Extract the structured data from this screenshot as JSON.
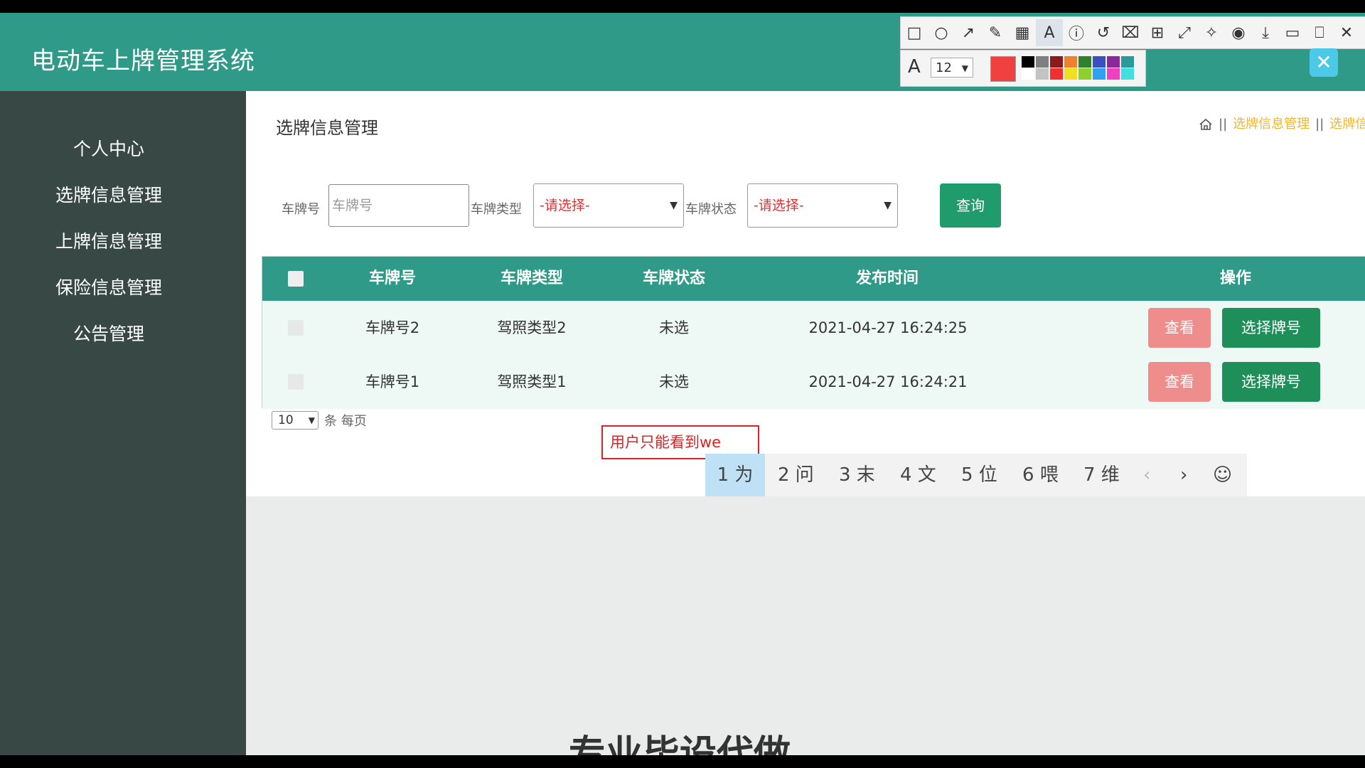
{
  "app": {
    "title": "电动车上牌管理系统"
  },
  "sidebar": {
    "items": [
      {
        "label": "个人中心"
      },
      {
        "label": "选牌信息管理"
      },
      {
        "label": "上牌信息管理"
      },
      {
        "label": "保险信息管理"
      },
      {
        "label": "公告管理"
      }
    ]
  },
  "page": {
    "title": "选牌信息管理"
  },
  "breadcrumb": {
    "items": [
      "选牌信息管理",
      "选牌信"
    ]
  },
  "search": {
    "plate_label": "车牌号",
    "plate_placeholder": "车牌号",
    "type_label": "车牌类型",
    "type_selected": "-请选择-",
    "status_label": "车牌状态",
    "status_selected": "-请选择-",
    "query_label": "查询"
  },
  "table": {
    "headers": [
      "车牌号",
      "车牌类型",
      "车牌状态",
      "发布时间",
      "操作"
    ],
    "rows": [
      {
        "plate": "车牌号2",
        "type": "驾照类型2",
        "status": "未选",
        "time": "2021-04-27 16:24:25",
        "view": "查看",
        "pick": "选择牌号"
      },
      {
        "plate": "车牌号1",
        "type": "驾照类型1",
        "status": "未选",
        "time": "2021-04-27 16:24:21",
        "view": "查看",
        "pick": "选择牌号"
      }
    ]
  },
  "pagination": {
    "per_page": "10",
    "per_page_label": "条 每页"
  },
  "annotation": {
    "text": "用户只能看到we"
  },
  "ime": {
    "candidates": [
      "1 为",
      "2 问",
      "3 末",
      "4 文",
      "5 位",
      "6 喂",
      "7 维"
    ],
    "prev": "‹",
    "next": "›",
    "emoji": "☺"
  },
  "overlay": {
    "bottom_text": "专业毕设代做"
  },
  "toolbar": {
    "font_size": "12"
  },
  "colors": {
    "primary": "#2f9a87",
    "sidebar": "#384844",
    "view": "#ef8d8d",
    "pick": "#1f8f5a",
    "query": "#1f9b6c",
    "accent_link": "#f1b62c"
  }
}
